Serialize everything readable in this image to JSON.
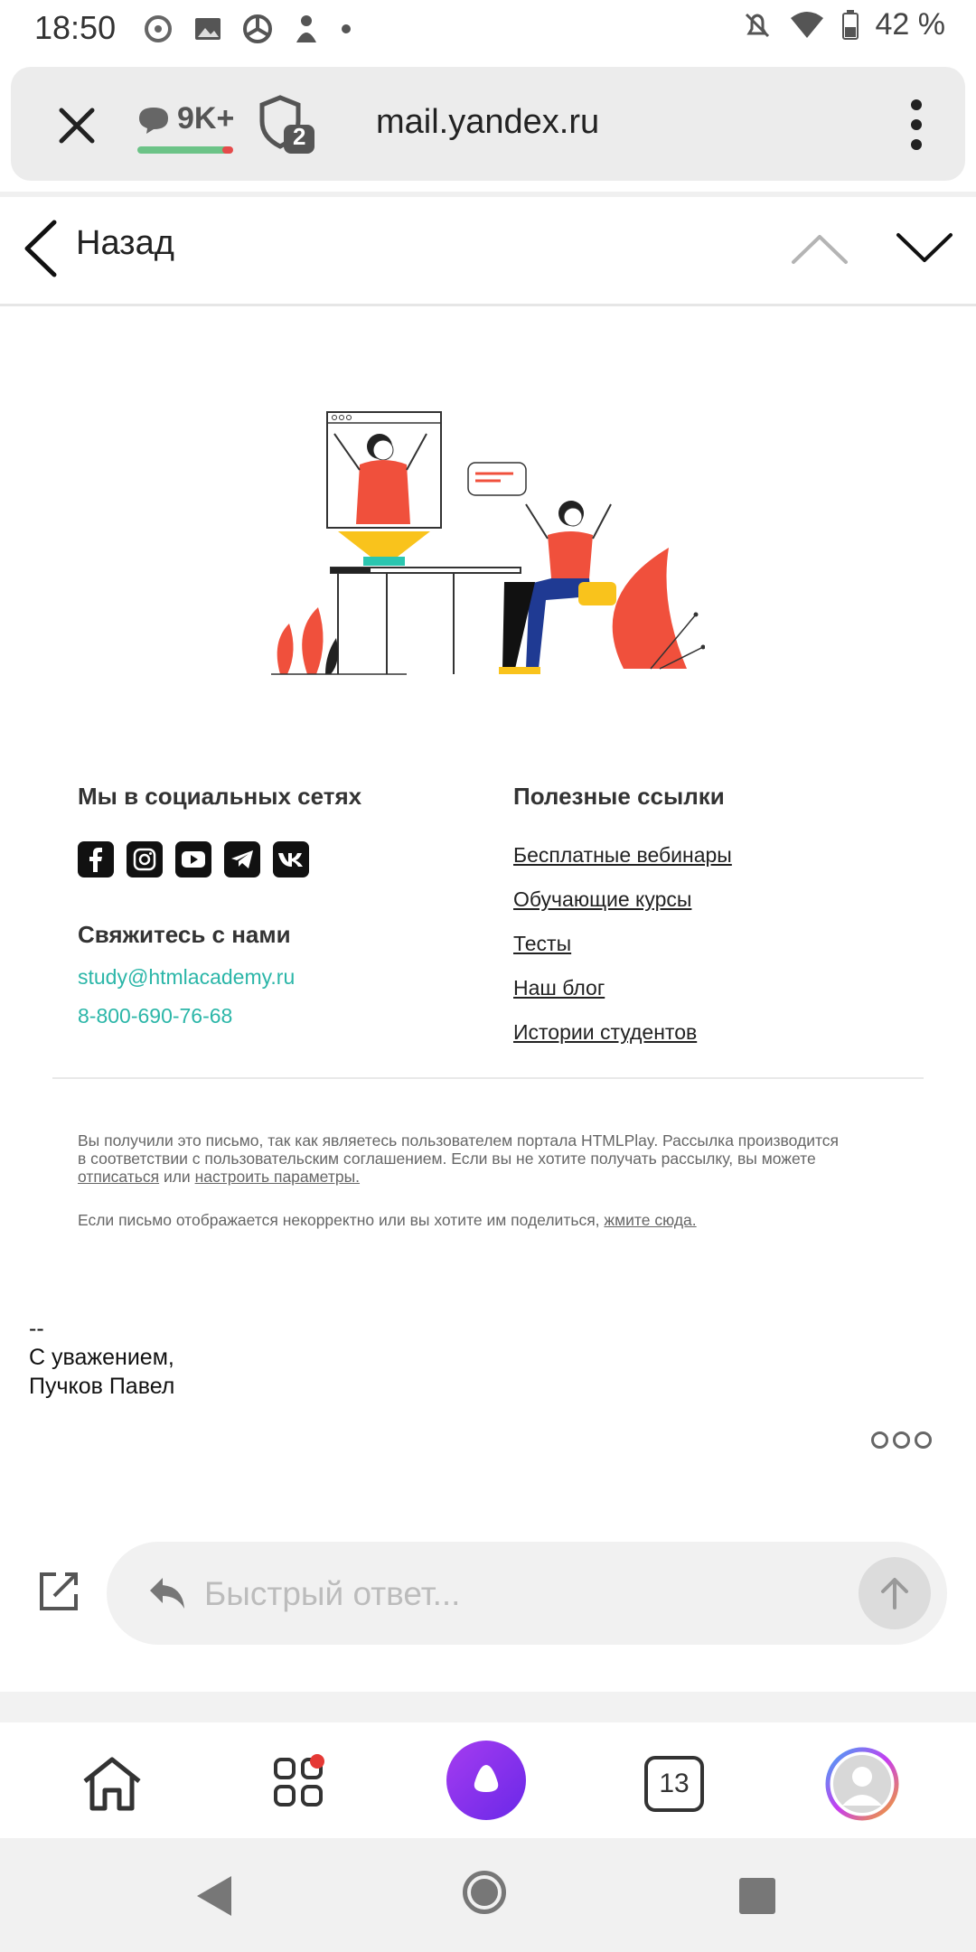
{
  "status_bar": {
    "time": "18:50",
    "battery": "42 %"
  },
  "browser": {
    "comments_count": "9K+",
    "shield_badge": "2",
    "url": "mail.yandex.ru"
  },
  "nav": {
    "back_label": "Назад"
  },
  "footer": {
    "social_heading": "Мы в социальных сетях",
    "social_icons": [
      "facebook-icon",
      "instagram-icon",
      "youtube-icon",
      "telegram-icon",
      "vk-icon"
    ],
    "contact_heading": "Свяжитесь с нами",
    "email": "study@htmlacademy.ru",
    "phone": "8-800-690-76-68",
    "links_heading": "Полезные ссылки",
    "links": [
      "Бесплатные вебинары",
      "Обучающие курсы",
      "Тесты",
      "Наш блог",
      "Истории студентов"
    ]
  },
  "legal": {
    "text_1": "Вы получили это письмо, так как являетесь пользователем портала HTMLPlay. Рассылка производится в соответствии с пользовательским соглашением. Если вы не хотите получать рассылку, вы можете ",
    "unsubscribe": "отписаться",
    "or": " или ",
    "settings": "настроить параметры.",
    "text_2": "Если письмо отображается некорректно или вы хотите им поделиться, ",
    "share_link": "жмите сюда."
  },
  "signature": {
    "dashes": "--",
    "regards": "С уважением,",
    "name": "Пучков Павел"
  },
  "quick_reply": {
    "placeholder": "Быстрый ответ..."
  },
  "bottom_nav": {
    "tabs_count": "13"
  },
  "colors": {
    "accent_teal": "#2bb6a8",
    "alice_purple": "#8a2be2",
    "illustration_red": "#f0503c",
    "illustration_yellow": "#f9c31c"
  }
}
